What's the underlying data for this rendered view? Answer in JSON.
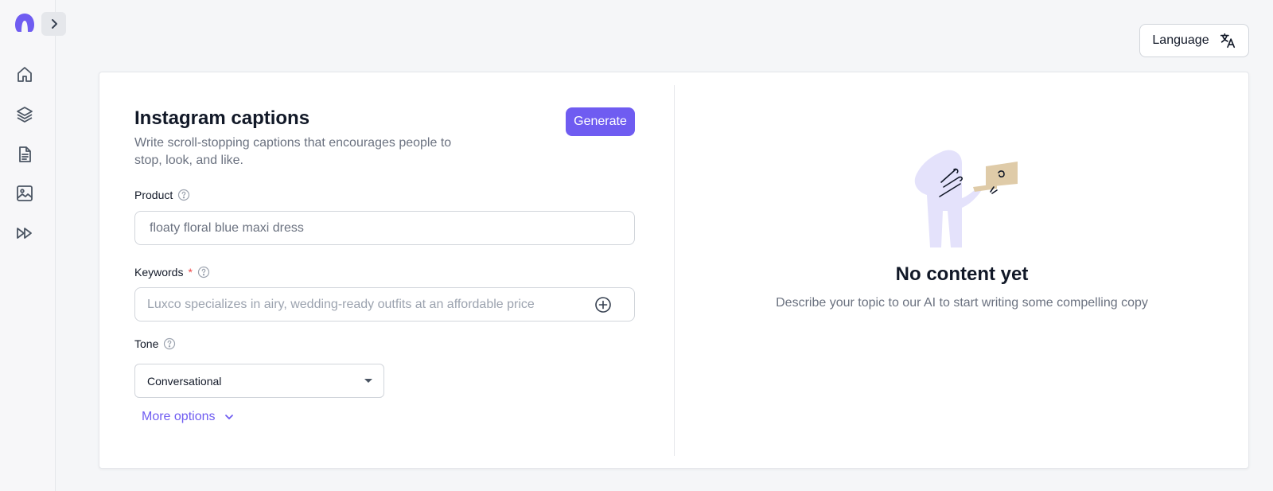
{
  "sidebar": {
    "logo_icon": "brand-logo-icon",
    "expand_icon": "chevron-right-icon",
    "items": [
      {
        "icon": "home-icon"
      },
      {
        "icon": "layers-icon"
      },
      {
        "icon": "document-icon"
      },
      {
        "icon": "image-icon"
      },
      {
        "icon": "fast-forward-icon"
      }
    ]
  },
  "header": {
    "language_label": "Language",
    "language_icon": "translate-icon"
  },
  "form": {
    "title": "Instagram captions",
    "subtitle": "Write scroll-stopping captions that encourages people to stop, look, and like.",
    "generate_label": "Generate",
    "product": {
      "label": "Product",
      "value": "floaty floral blue maxi dress"
    },
    "keywords": {
      "label": "Keywords",
      "required_mark": "*",
      "placeholder": "Luxco specializes in airy, wedding-ready outfits at an affordable price"
    },
    "tone": {
      "label": "Tone",
      "selected": "Conversational"
    },
    "more_options_label": "More options"
  },
  "output": {
    "empty_title": "No content yet",
    "empty_description": "Describe your topic to our AI to start writing some compelling copy"
  },
  "colors": {
    "accent": "#6f5cf1",
    "illustration_fill": "#e4e2fb",
    "laptop": "#dfcba8"
  }
}
